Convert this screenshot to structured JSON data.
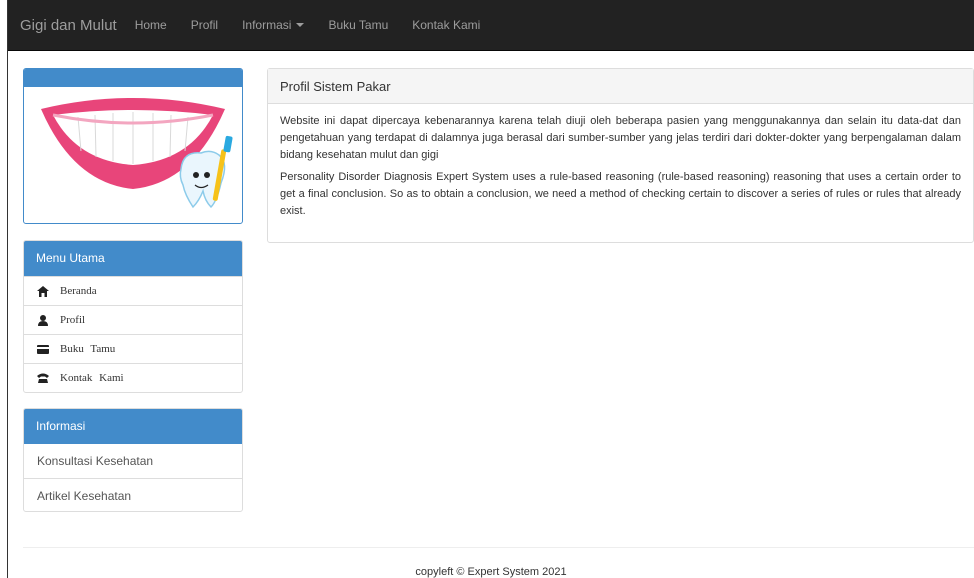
{
  "navbar": {
    "brand": "Gigi dan Mulut",
    "links": [
      "Home",
      "Profil",
      "Informasi",
      "Buku Tamu",
      "Kontak Kami"
    ]
  },
  "sidebar": {
    "menu_title": "Menu Utama",
    "menu_items": [
      {
        "label": "Beranda",
        "icon": "home-icon"
      },
      {
        "label": "Profil",
        "icon": "user-icon"
      },
      {
        "label": "Buku Tamu",
        "icon": "card-icon"
      },
      {
        "label": "Kontak Kami",
        "icon": "phone-icon"
      }
    ],
    "info_title": "Informasi",
    "info_items": [
      "Konsultasi Kesehatan",
      "Artikel Kesehatan"
    ]
  },
  "main": {
    "panel_title": "Profil Sistem Pakar",
    "paragraph_1": "Website ini dapat dipercaya kebenarannya karena telah diuji oleh beberapa pasien yang menggunakannya dan selain itu data-dat dan pengetahuan yang terdapat di dalamnya juga berasal dari sumber-sumber yang jelas terdiri dari dokter-dokter yang berpengalaman dalam bidang kesehatan mulut dan gigi",
    "paragraph_2": "Personality Disorder Diagnosis Expert System uses a rule-based reasoning (rule-based reasoning) reasoning that uses a certain order to get a final conclusion. So as to obtain a conclusion, we need a method of checking certain to discover a series of rules or rules that already exist."
  },
  "footer": {
    "text": "copyleft © Expert System 2021"
  },
  "colors": {
    "navbar_bg": "#222222",
    "panel_primary": "#428bca",
    "panel_default_head": "#f5f5f5"
  }
}
